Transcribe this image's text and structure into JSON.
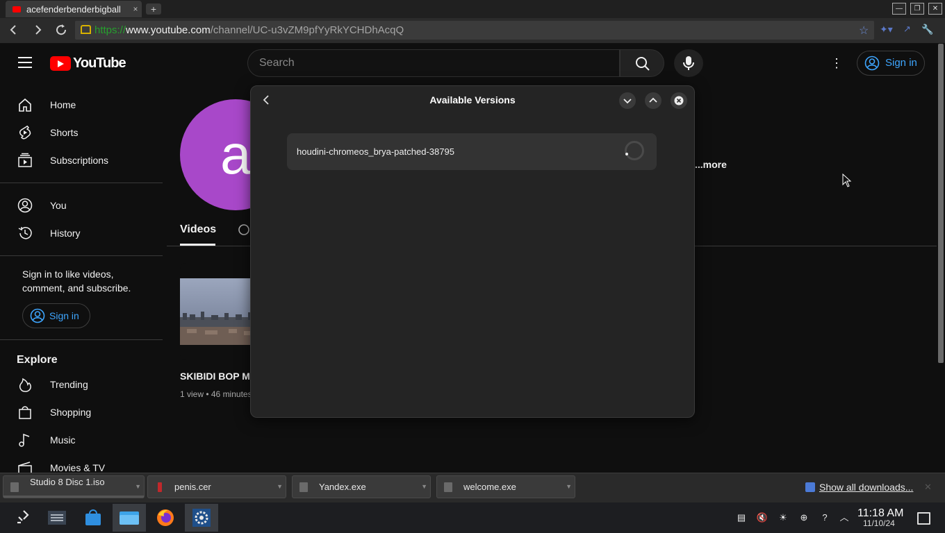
{
  "browser": {
    "tab_title": "acefenderbenderbigball",
    "tab_close": "×",
    "new_tab": "+",
    "url_scheme": "https://",
    "url_host": "www.youtube.com",
    "url_path": "/channel/UC-u3vZM9pfYyRkYCHDhAcqQ",
    "window_buttons": [
      "—",
      "❐",
      "✕"
    ]
  },
  "youtube": {
    "logo_text": "YouTube",
    "search_placeholder": "Search",
    "header_signin": "Sign in",
    "sidebar": {
      "items": [
        {
          "label": "Home",
          "icon": "home-icon"
        },
        {
          "label": "Shorts",
          "icon": "shorts-icon"
        },
        {
          "label": "Subscriptions",
          "icon": "subscriptions-icon"
        },
        {
          "label": "You",
          "icon": "you-icon"
        },
        {
          "label": "History",
          "icon": "history-icon"
        }
      ],
      "signin_prompt": "Sign in to like videos, comment, and subscribe.",
      "signin_button": "Sign in",
      "explore_heading": "Explore",
      "explore_items": [
        {
          "label": "Trending",
          "icon": "trending-icon"
        },
        {
          "label": "Shopping",
          "icon": "shopping-icon"
        },
        {
          "label": "Music",
          "icon": "music-icon"
        },
        {
          "label": "Movies & TV",
          "icon": "movies-icon"
        }
      ]
    },
    "channel": {
      "avatar_letter": "a",
      "more_link": "...more",
      "tab_videos": "Videos",
      "video": {
        "title": "SKIBIDI BOP MM",
        "meta": "1 view • 46 minutes"
      }
    }
  },
  "dialog": {
    "title": "Available Versions",
    "versions": [
      "houdini-chromeos_brya-patched-38795"
    ]
  },
  "downloads": {
    "items": [
      "Studio 8 Disc 1.iso",
      "penis.cer",
      "Yandex.exe",
      "welcome.exe"
    ],
    "show_all": "Show all downloads...",
    "close": "✕"
  },
  "taskbar": {
    "time": "11:18 AM",
    "date": "11/10/24"
  },
  "colors": {
    "youtube_red": "#ff0000",
    "link_blue": "#3ea6ff",
    "avatar_purple": "#a848c9"
  }
}
